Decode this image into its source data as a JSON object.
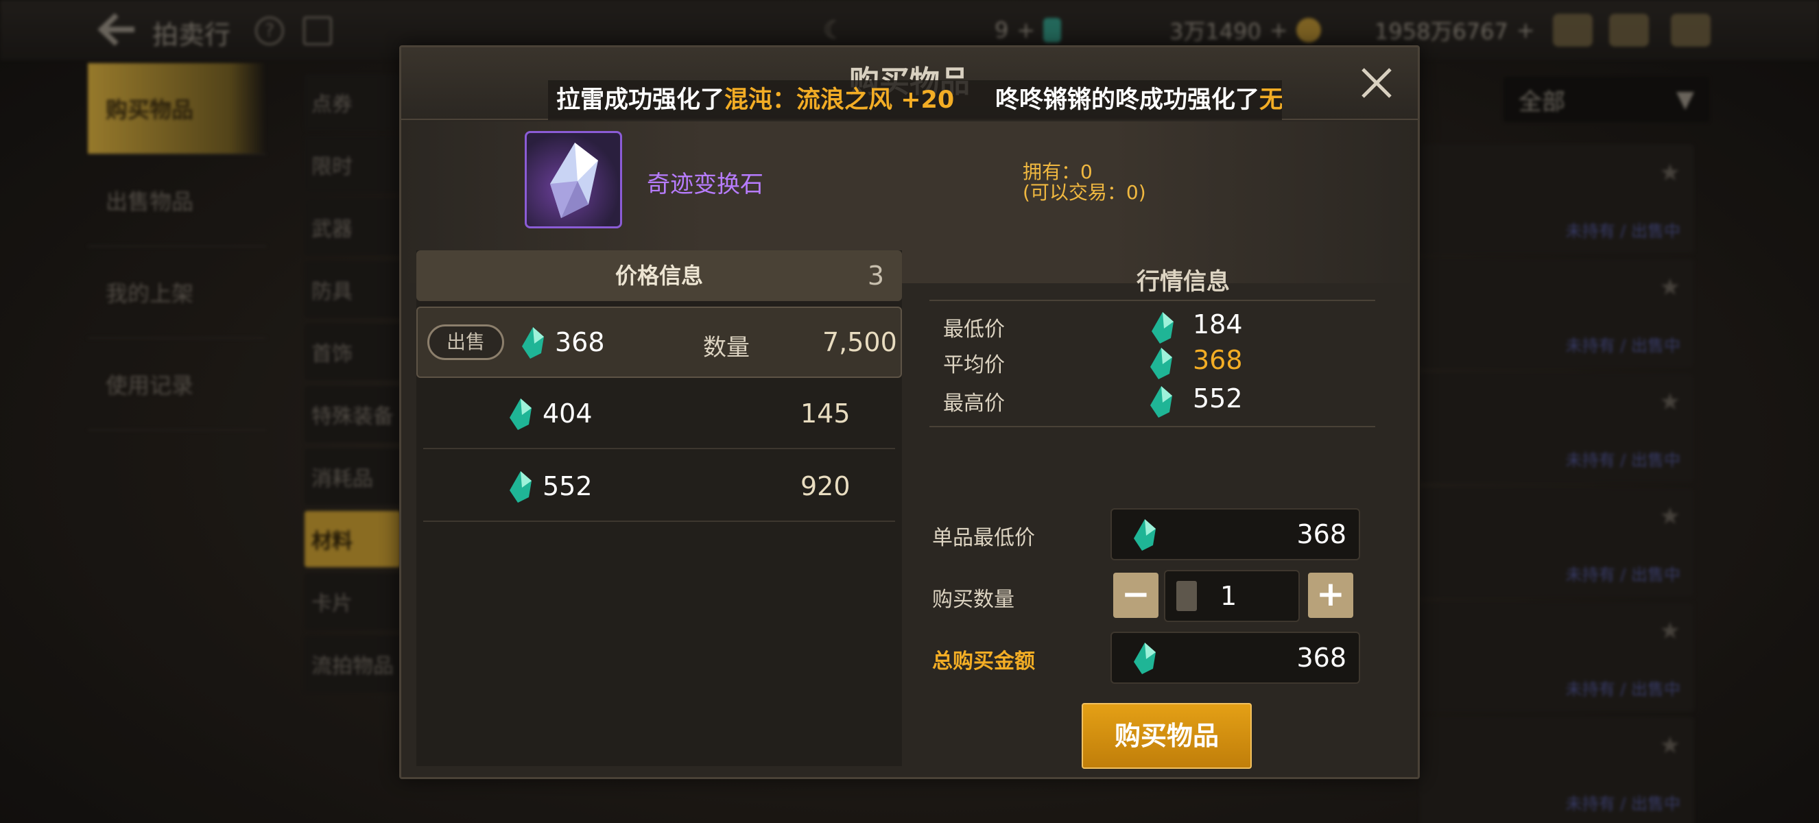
{
  "background": {
    "top_title": "拍卖行",
    "currency_1": "9",
    "currency_2": "3万1490",
    "currency_3": "1958万6767",
    "left_nav": [
      "购买物品",
      "出售物品",
      "我的上架",
      "使用记录"
    ],
    "sub_nav": [
      "点券",
      "限时",
      "武器",
      "防具",
      "首饰",
      "特殊装备",
      "消耗品",
      "材料",
      "卡片",
      "流拍物品"
    ],
    "filter_dropdown": "全部",
    "list_status_owned": "未持有",
    "list_status_selling": "出售中"
  },
  "dialog": {
    "title": "购买物品",
    "marquee_1": {
      "prefix": "拉雷成功强化了",
      "highlight": "混沌：流浪之风 +20"
    },
    "marquee_2": {
      "prefix": "咚咚锵锵的咚成功强化了",
      "highlight": "无"
    },
    "item": {
      "name": "奇迹变换石",
      "owned": "拥有：0",
      "tradable": "(可以交易：0)"
    },
    "price_info": {
      "header": "价格信息",
      "count": "3",
      "sell_label": "出售",
      "qty_label": "数量",
      "rows": [
        {
          "price": "368",
          "qty": "7,500"
        },
        {
          "price": "404",
          "qty": "145"
        },
        {
          "price": "552",
          "qty": "920"
        }
      ]
    },
    "market_info": {
      "header": "行情信息",
      "rows": [
        {
          "label": "最低价",
          "value": "184"
        },
        {
          "label": "平均价",
          "value": "368"
        },
        {
          "label": "最高价",
          "value": "552"
        }
      ]
    },
    "form": {
      "unit_price_label": "单品最低价",
      "unit_price": "368",
      "quantity_label": "购买数量",
      "quantity": "1",
      "minus": "−",
      "plus": "+",
      "total_label": "总购买金额",
      "total": "368",
      "buy_button": "购买物品"
    }
  },
  "colors": {
    "accent_gold": "#f3ad25",
    "rare_purple": "#b77cff",
    "gem_teal": "#2fd0b0"
  }
}
